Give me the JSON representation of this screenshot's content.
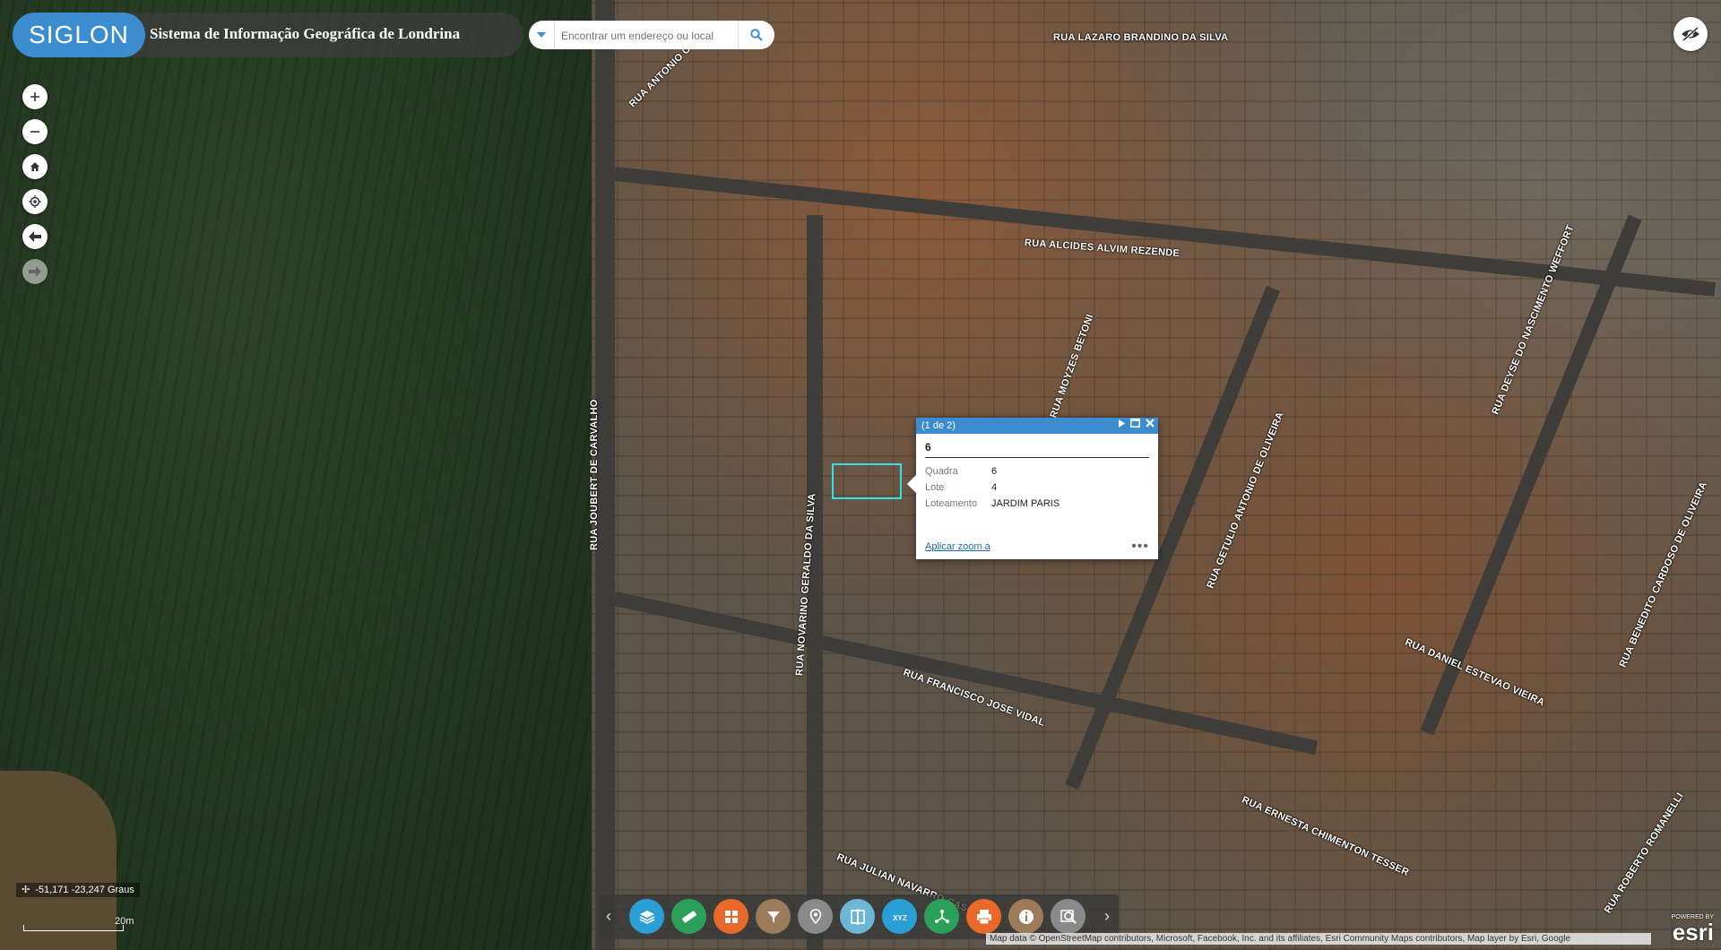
{
  "header": {
    "logo_text": "SIGLON",
    "title": "Sistema de Informação Geográfica de Londrina"
  },
  "search": {
    "placeholder": "Encontrar um endereço ou local"
  },
  "streets": [
    "RUA LAZARO BRANDINO DA SILVA",
    "RUA ANTONIO C",
    "RUA ALCIDES ALVIM REZENDE",
    "RUA DEYSE DO NASCIMENTO WEFFORT",
    "RUA MOYZES BETONI",
    "RUA JOUBERT DE CARVALHO",
    "RUA NOVARINO GERALDO DA SILVA",
    "RUA GETULIO ANTONIO DE OLIVEIRA",
    "RUA BENEDITO CARDOSO DE OLIVEIRA",
    "RUA DANIEL ESTEVAO VIEIRA",
    "RUA FRANCISCO JOSE VIDAL",
    "RUA ERNESTA CHIMENTON TESSER",
    "RUA ROBERTO ROMANELLI",
    "RUA JULIAN NAVARRO CASCO"
  ],
  "popup": {
    "counter": "(1 de 2)",
    "title": "6",
    "fields": [
      {
        "key": "Quadra",
        "value": "6"
      },
      {
        "key": "Lote",
        "value": "4"
      },
      {
        "key": "Loteamento",
        "value": "JARDIM PARIS"
      }
    ],
    "zoom_link": "Aplicar zoom a",
    "more": "•••"
  },
  "coords": "-51,171 -23,247 Graus",
  "scale_label": "20m",
  "toolbar": {
    "tools": [
      {
        "name": "layers-tool",
        "icon": "layers-icon",
        "color": "#2a9fd6"
      },
      {
        "name": "measure-tool",
        "icon": "ruler-icon",
        "color": "#2aa05a"
      },
      {
        "name": "basemap-tool",
        "icon": "grid-icon",
        "color": "#e8692a"
      },
      {
        "name": "filter-tool",
        "icon": "filter-icon",
        "color": "#9c7b5a"
      },
      {
        "name": "location-tool",
        "icon": "pin-icon",
        "color": "#8a8a8a"
      },
      {
        "name": "swipe-tool",
        "icon": "swipe-icon",
        "color": "#6ab7d8"
      },
      {
        "name": "xyz-tool",
        "icon": "xyz-icon",
        "color": "#2a9fd6"
      },
      {
        "name": "share-tool",
        "icon": "share-icon",
        "color": "#2aa05a"
      },
      {
        "name": "print-tool",
        "icon": "printer-icon",
        "color": "#e8692a"
      },
      {
        "name": "info-tool",
        "icon": "info-icon",
        "color": "#9c7b5a"
      },
      {
        "name": "query-tool",
        "icon": "query-icon",
        "color": "#8a8a8a"
      }
    ]
  },
  "attribution": "Map data © OpenStreetMap contributors, Microsoft, Facebook, Inc. and its affiliates, Esri Community Maps contributors, Map layer by Esri, Google",
  "esri": {
    "powered": "POWERED BY",
    "brand": "esri"
  }
}
